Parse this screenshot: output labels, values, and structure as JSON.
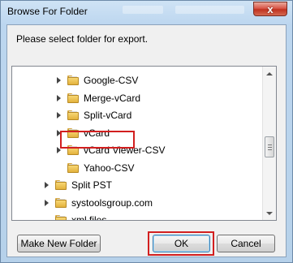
{
  "window": {
    "title": "Browse For Folder",
    "close_label": "x"
  },
  "dialog": {
    "prompt": "Please select folder for export."
  },
  "tree": {
    "items": [
      {
        "label": "Google-CSV",
        "expandable": true,
        "level": 2
      },
      {
        "label": "Merge-vCard",
        "expandable": true,
        "level": 2
      },
      {
        "label": "Split-vCard",
        "expandable": true,
        "level": 2
      },
      {
        "label": "vCard",
        "expandable": true,
        "level": 2
      },
      {
        "label": "vCard Viewer-CSV",
        "expandable": true,
        "level": 2
      },
      {
        "label": "Yahoo-CSV",
        "expandable": false,
        "level": 2,
        "selected": true
      },
      {
        "label": "Split PST",
        "expandable": true,
        "level": 1
      },
      {
        "label": "systoolsgroup.com",
        "expandable": true,
        "level": 1
      },
      {
        "label": "xml files",
        "expandable": false,
        "level": 1
      }
    ]
  },
  "buttons": {
    "new_folder": "Make New Folder",
    "ok": "OK",
    "cancel": "Cancel"
  },
  "colors": {
    "highlight": "#d21f1f",
    "title_gradient": "#bcd6ef",
    "client_bg": "#f0f0f0"
  }
}
